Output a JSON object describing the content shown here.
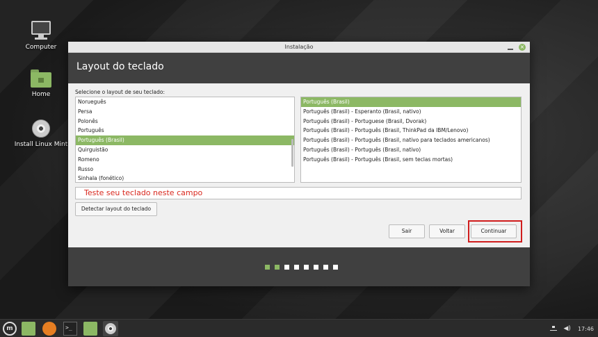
{
  "desktop": {
    "icons": [
      {
        "label": "Computer"
      },
      {
        "label": "Home"
      },
      {
        "label": "Install Linux Mint"
      }
    ]
  },
  "window": {
    "title": "Instalação",
    "heading": "Layout do teclado",
    "select_label": "Selecione o layout de seu teclado:",
    "layouts": [
      "Norueguês",
      "Persa",
      "Polonês",
      "Português",
      "Português (Brasil)",
      "Quirguistão",
      "Romeno",
      "Russo",
      "Sinhala (fonético)"
    ],
    "selected_layout_index": 4,
    "variants": [
      "Português (Brasil)",
      "Português (Brasil) - Esperanto (Brasil, nativo)",
      "Português (Brasil) - Portuguese (Brasil, Dvorak)",
      "Português (Brasil) - Português (Brasil, ThinkPad da IBM/Lenovo)",
      "Português (Brasil) - Português (Brasil, nativo para teclados americanos)",
      "Português (Brasil) - Português (Brasil, nativo)",
      "Português (Brasil) - Português (Brasil, sem teclas mortas)"
    ],
    "selected_variant_index": 0,
    "test_field_placeholder": "Teste seu teclado neste campo",
    "detect_button": "Detectar layout do teclado",
    "quit_button": "Sair",
    "back_button": "Voltar",
    "continue_button": "Continuar",
    "progress": {
      "total_steps": 8,
      "completed_steps": 2
    },
    "accent_color": "#8cb864",
    "highlight_color": "#d01c1c"
  },
  "taskbar": {
    "clock": "17:46"
  }
}
